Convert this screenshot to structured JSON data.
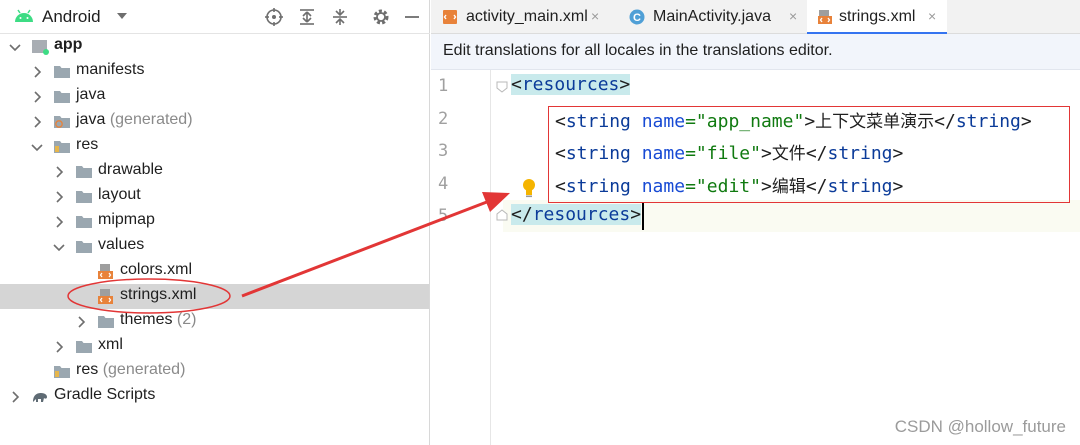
{
  "project_panel": {
    "view_selector": "Android",
    "toolbar_icons": [
      "locate-icon",
      "expand-all-icon",
      "collapse-all-icon",
      "gear-icon",
      "minimize-icon"
    ],
    "tree": [
      {
        "label": "app",
        "suffix": "",
        "icon": "module-icon",
        "bold": true,
        "expanded": true
      },
      {
        "label": "manifests",
        "suffix": "",
        "icon": "folder-icon",
        "expanded": false
      },
      {
        "label": "java",
        "suffix": "",
        "icon": "folder-icon",
        "expanded": false
      },
      {
        "label": "java",
        "suffix": "(generated)",
        "icon": "generated-folder-icon",
        "expanded": false
      },
      {
        "label": "res",
        "suffix": "",
        "icon": "resource-folder-icon",
        "expanded": true
      },
      {
        "label": "drawable",
        "suffix": "",
        "icon": "folder-icon",
        "expanded": false
      },
      {
        "label": "layout",
        "suffix": "",
        "icon": "folder-icon",
        "expanded": false
      },
      {
        "label": "mipmap",
        "suffix": "",
        "icon": "folder-icon",
        "expanded": false
      },
      {
        "label": "values",
        "suffix": "",
        "icon": "folder-icon",
        "expanded": true
      },
      {
        "label": "colors.xml",
        "suffix": "",
        "icon": "xml-file-icon"
      },
      {
        "label": "strings.xml",
        "suffix": "",
        "icon": "xml-file-icon",
        "selected": true
      },
      {
        "label": "themes",
        "suffix": "(2)",
        "icon": "folder-icon",
        "expanded": false
      },
      {
        "label": "xml",
        "suffix": "",
        "icon": "folder-icon",
        "expanded": false
      },
      {
        "label": "res",
        "suffix": "(generated)",
        "icon": "resource-folder-icon"
      },
      {
        "label": "Gradle Scripts",
        "suffix": "",
        "icon": "gradle-icon",
        "expanded": false
      }
    ]
  },
  "editor": {
    "tabs": [
      {
        "label": "activity_main.xml",
        "icon": "layout-xml-icon",
        "active": false
      },
      {
        "label": "MainActivity.java",
        "icon": "java-class-icon",
        "active": false
      },
      {
        "label": "strings.xml",
        "icon": "xml-file-icon",
        "active": true
      }
    ],
    "close_glyph": "×",
    "notice": "Edit translations for all locales in the translations editor.",
    "line_numbers": [
      "1",
      "2",
      "3",
      "4",
      "5"
    ],
    "code": {
      "open_tag": "resources",
      "close_tag": "resources",
      "strings": [
        {
          "tag": "string",
          "attr": "name",
          "value": "app_name",
          "text": "上下文菜单演示"
        },
        {
          "tag": "string",
          "attr": "name",
          "value": "file",
          "text": "文件"
        },
        {
          "tag": "string",
          "attr": "name",
          "value": "edit",
          "text": "编辑"
        }
      ]
    }
  },
  "watermark": "CSDN @hollow_future",
  "colors": {
    "annotation": "#e23636",
    "tag_highlight": "#c9eaec",
    "selection": "#d5d5d5",
    "tab_underline": "#3574f0"
  }
}
